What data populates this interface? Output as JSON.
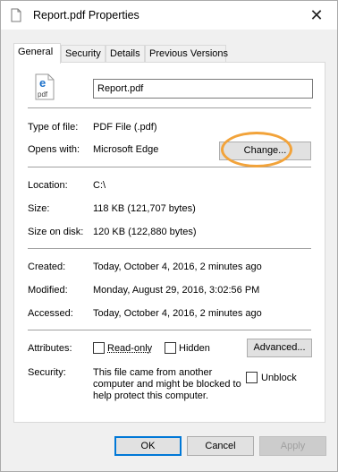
{
  "window": {
    "title": "Report.pdf Properties"
  },
  "tabs": [
    {
      "label": "General",
      "active": true
    },
    {
      "label": "Security",
      "active": false
    },
    {
      "label": "Details",
      "active": false
    },
    {
      "label": "Previous Versions",
      "active": false
    }
  ],
  "file": {
    "name": "Report.pdf",
    "icon": "pdf-file-icon"
  },
  "type": {
    "label": "Type of file:",
    "value": "PDF File (.pdf)"
  },
  "opens": {
    "label": "Opens with:",
    "value": "Microsoft Edge",
    "change_button": "Change..."
  },
  "location": {
    "label": "Location:",
    "value": "C:\\"
  },
  "size": {
    "label": "Size:",
    "value": "118 KB (121,707 bytes)"
  },
  "size_on_disk": {
    "label": "Size on disk:",
    "value": "120 KB (122,880 bytes)"
  },
  "created": {
    "label": "Created:",
    "value": "Today, October 4, 2016, 2 minutes ago"
  },
  "modified": {
    "label": "Modified:",
    "value": "Monday, August 29, 2016, 3:02:56 PM"
  },
  "accessed": {
    "label": "Accessed:",
    "value": "Today, October 4, 2016, 2 minutes ago"
  },
  "attributes": {
    "label": "Attributes:",
    "readonly_label": "Read-only",
    "readonly_checked": false,
    "hidden_label": "Hidden",
    "hidden_checked": false,
    "advanced_button": "Advanced..."
  },
  "security": {
    "label": "Security:",
    "text": "This file came from another computer and might be blocked to help protect this computer.",
    "unblock_label": "Unblock",
    "unblock_checked": false
  },
  "footer": {
    "ok": "OK",
    "cancel": "Cancel",
    "apply": "Apply"
  },
  "colors": {
    "highlight": "#f2a33a",
    "accent": "#0078d7"
  }
}
